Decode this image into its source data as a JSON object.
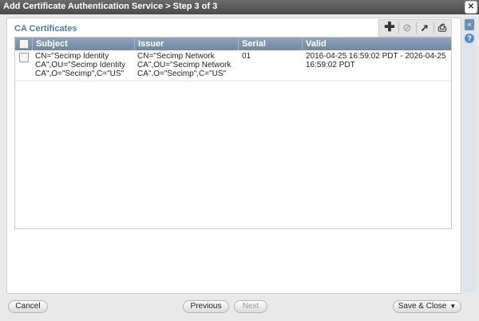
{
  "window": {
    "title": "Add Certificate Authentication Service > Step 3 of 3",
    "close_glyph": "✕"
  },
  "section": {
    "title": "CA Certificates"
  },
  "toolbar": {
    "add_icon": "plus-icon",
    "disable_icon": "disable-icon",
    "export_icon": "export-icon",
    "print_icon": "print-icon"
  },
  "side": {
    "collapse_glyph": "«",
    "help_glyph": "?"
  },
  "table": {
    "columns": [
      "Subject",
      "Issuer",
      "Serial",
      "Valid"
    ],
    "rows": [
      {
        "subject_lines": [
          "CN=\"Secimp Identity",
          "CA\",OU=\"Secimp Identity",
          "CA\",O=\"Secimp\",C=\"US\""
        ],
        "issuer_lines": [
          "CN=\"Secimp Network",
          "CA\",OU=\"Secimp Network",
          "CA\",O=\"Secimp\",C=\"US\""
        ],
        "serial": "01",
        "valid_lines": [
          "2016-04-25 16:59:02 PDT - 2026-04-25",
          "16:59:02 PDT"
        ]
      }
    ]
  },
  "footer": {
    "cancel": "Cancel",
    "previous": "Previous",
    "next": "Next",
    "save_close": "Save & Close"
  },
  "colors": {
    "accent": "#4a7ab3",
    "header": "#7b91ab"
  }
}
